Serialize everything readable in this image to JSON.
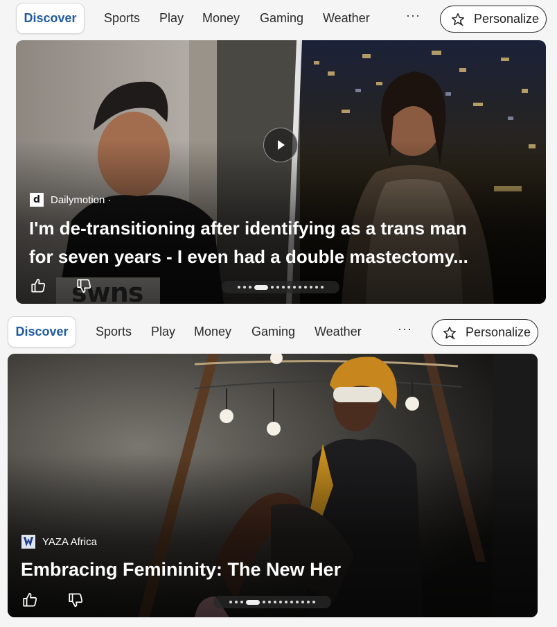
{
  "nav_a": {
    "discover": "Discover",
    "links": [
      "Sports",
      "Play",
      "Money",
      "Gaming",
      "Weather"
    ],
    "more": "···",
    "personalize": "Personalize"
  },
  "card_a": {
    "source": "Dailymotion ·",
    "source_logo_letter": "d",
    "headline_line1": "I'm de-transitioning after identifying as a trans man",
    "headline_line2": "for seven years - I even had a double mastectomy...",
    "watermark": "swns",
    "pager_dots": 14,
    "pager_active_index": 3,
    "has_video": true
  },
  "nav_b": {
    "discover": "Discover",
    "links": [
      "Sports",
      "Play",
      "Money",
      "Gaming",
      "Weather"
    ],
    "more": "···",
    "personalize": "Personalize"
  },
  "card_b": {
    "source": "YAZA Africa",
    "headline": "Embracing Femininity: The New Her",
    "pager_dots": 14,
    "pager_active_index": 3
  },
  "colors": {
    "accent": "#1f5aa0",
    "panel_bg": "#f5f5f5"
  },
  "icons": [
    "star-personalize-icon",
    "thumbs-up-icon",
    "thumbs-down-icon",
    "play-icon"
  ]
}
